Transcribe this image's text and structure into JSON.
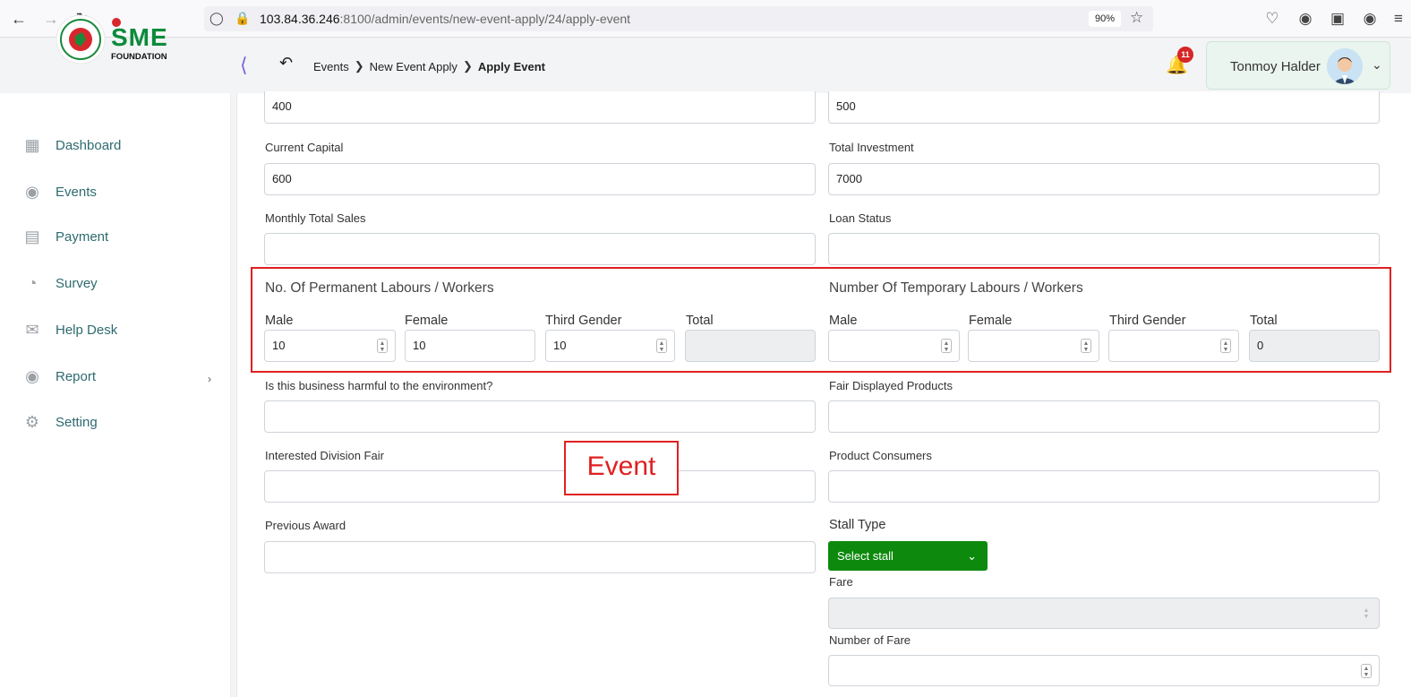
{
  "browser": {
    "url_host": "103.84.36.246",
    "url_rest": ":8100/admin/events/new-event-apply/24/apply-event",
    "zoom": "90%"
  },
  "header": {
    "logo_text": "SME",
    "logo_subtext": "FOUNDATION",
    "breadcrumb": [
      "Events",
      "New Event Apply",
      "Apply Event"
    ],
    "notification_count": "11",
    "user_name": "Tonmoy Halder"
  },
  "sidebar": {
    "items": [
      {
        "label": "Dashboard",
        "icon": "grid-icon"
      },
      {
        "label": "Events",
        "icon": "lock-circle-icon"
      },
      {
        "label": "Payment",
        "icon": "cash-icon"
      },
      {
        "label": "Survey",
        "icon": "pie-chart-icon"
      },
      {
        "label": "Help Desk",
        "icon": "mail-icon"
      },
      {
        "label": "Report",
        "icon": "lock-circle-icon"
      },
      {
        "label": "Setting",
        "icon": "gear-icon"
      }
    ]
  },
  "form": {
    "top_left_value": "400",
    "top_right_value": "500",
    "current_capital_label": "Current Capital",
    "current_capital_value": "600",
    "total_investment_label": "Total Investment",
    "total_investment_value": "7000",
    "monthly_sales_label": "Monthly Total Sales",
    "monthly_sales_value": "",
    "loan_status_label": "Loan Status",
    "loan_status_value": "",
    "permanent_title": "No. Of Permanent Labours / Workers",
    "temporary_title": "Number Of Temporary Labours / Workers",
    "male_label": "Male",
    "female_label": "Female",
    "third_gender_label": "Third Gender",
    "total_label": "Total",
    "perm_male": "10",
    "perm_female": "10",
    "perm_third": "10",
    "perm_total": "",
    "temp_male": "",
    "temp_female": "",
    "temp_third": "",
    "temp_total": "0",
    "harmful_label": "Is this business harmful to the environment?",
    "fair_products_label": "Fair Displayed Products",
    "division_fair_label": "Interested Division Fair",
    "consumers_label": "Product Consumers",
    "previous_award_label": "Previous Award",
    "stall_type_label": "Stall Type",
    "stall_select": "Select stall",
    "fare_label": "Fare",
    "number_of_fare_label": "Number of Fare"
  },
  "annotation": {
    "label": "Event",
    "color": "#e02020"
  }
}
